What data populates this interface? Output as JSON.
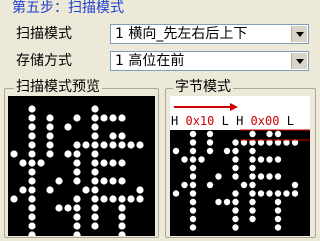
{
  "step": {
    "title": "第五步：扫描模式"
  },
  "scan_mode": {
    "label": "扫描模式",
    "value": "1 横向_先左右后上下"
  },
  "storage_mode": {
    "label": "存储方式",
    "value": "1 高位在前"
  },
  "scan_preview": {
    "title": "扫描模式预览"
  },
  "byte_mode": {
    "title": "字节模式",
    "byte_row": {
      "h1": "H",
      "v1": "0x10",
      "l1": "L",
      "h2": "H",
      "v2": "0x00",
      "l2": "L"
    }
  },
  "colors": {
    "title_blue": "#1f3fd0",
    "dot_white": "#ffffff",
    "panel_black": "#000000",
    "highlight_red": "#d00000"
  }
}
